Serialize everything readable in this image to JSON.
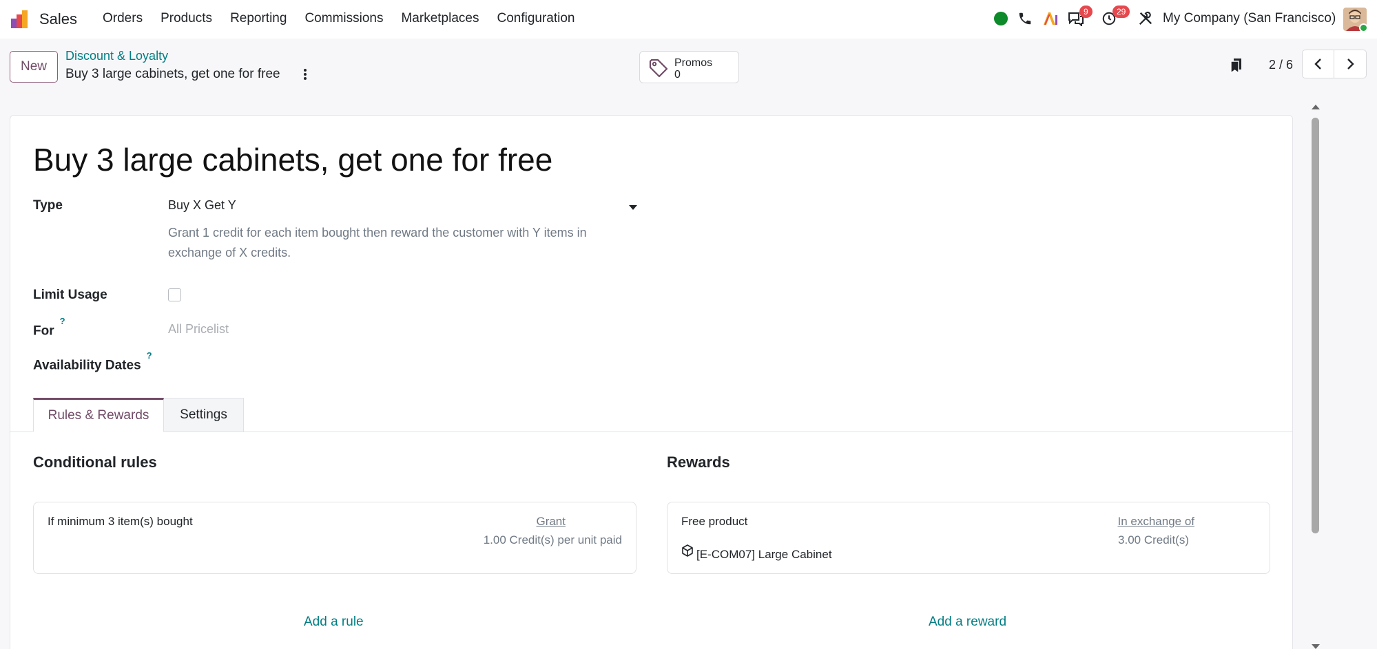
{
  "navbar": {
    "app_name": "Sales",
    "menu": [
      {
        "label": "Orders"
      },
      {
        "label": "Products"
      },
      {
        "label": "Reporting"
      },
      {
        "label": "Commissions"
      },
      {
        "label": "Marketplaces"
      },
      {
        "label": "Configuration"
      }
    ],
    "messages_badge": "9",
    "activities_badge": "29",
    "company": "My Company (San Francisco)",
    "colors": {
      "brand": "#714b67",
      "link": "#017e84",
      "badge": "#e5484d",
      "online": "#28a745"
    }
  },
  "control_panel": {
    "new_label": "New",
    "breadcrumb_parent": "Discount & Loyalty",
    "breadcrumb_current": "Buy 3 large cabinets, get one for free",
    "promos_label": "Promos",
    "promos_count": "0",
    "pager": "2 / 6"
  },
  "form": {
    "title": "Buy 3 large cabinets, get one for free",
    "type_label": "Type",
    "type_value": "Buy X Get Y",
    "type_description": "Grant 1 credit for each item bought then reward the customer with Y items in exchange of X credits.",
    "limit_usage_label": "Limit Usage",
    "limit_usage_checked": false,
    "for_label": "For",
    "for_placeholder": "All Pricelist",
    "availability_label": "Availability Dates",
    "help_mark": "?"
  },
  "tabs": [
    {
      "label": "Rules & Rewards",
      "active": true
    },
    {
      "label": "Settings",
      "active": false
    }
  ],
  "rules": {
    "title": "Conditional rules",
    "card_text": "If minimum 3 item(s) bought",
    "card_head": "Grant",
    "card_sub": "1.00 Credit(s) per unit paid",
    "add_label": "Add a rule"
  },
  "rewards": {
    "title": "Rewards",
    "card_text": "Free product",
    "product": "[E-COM07] Large Cabinet",
    "card_head": "In exchange of",
    "card_sub": "3.00 Credit(s)",
    "add_label": "Add a reward"
  }
}
